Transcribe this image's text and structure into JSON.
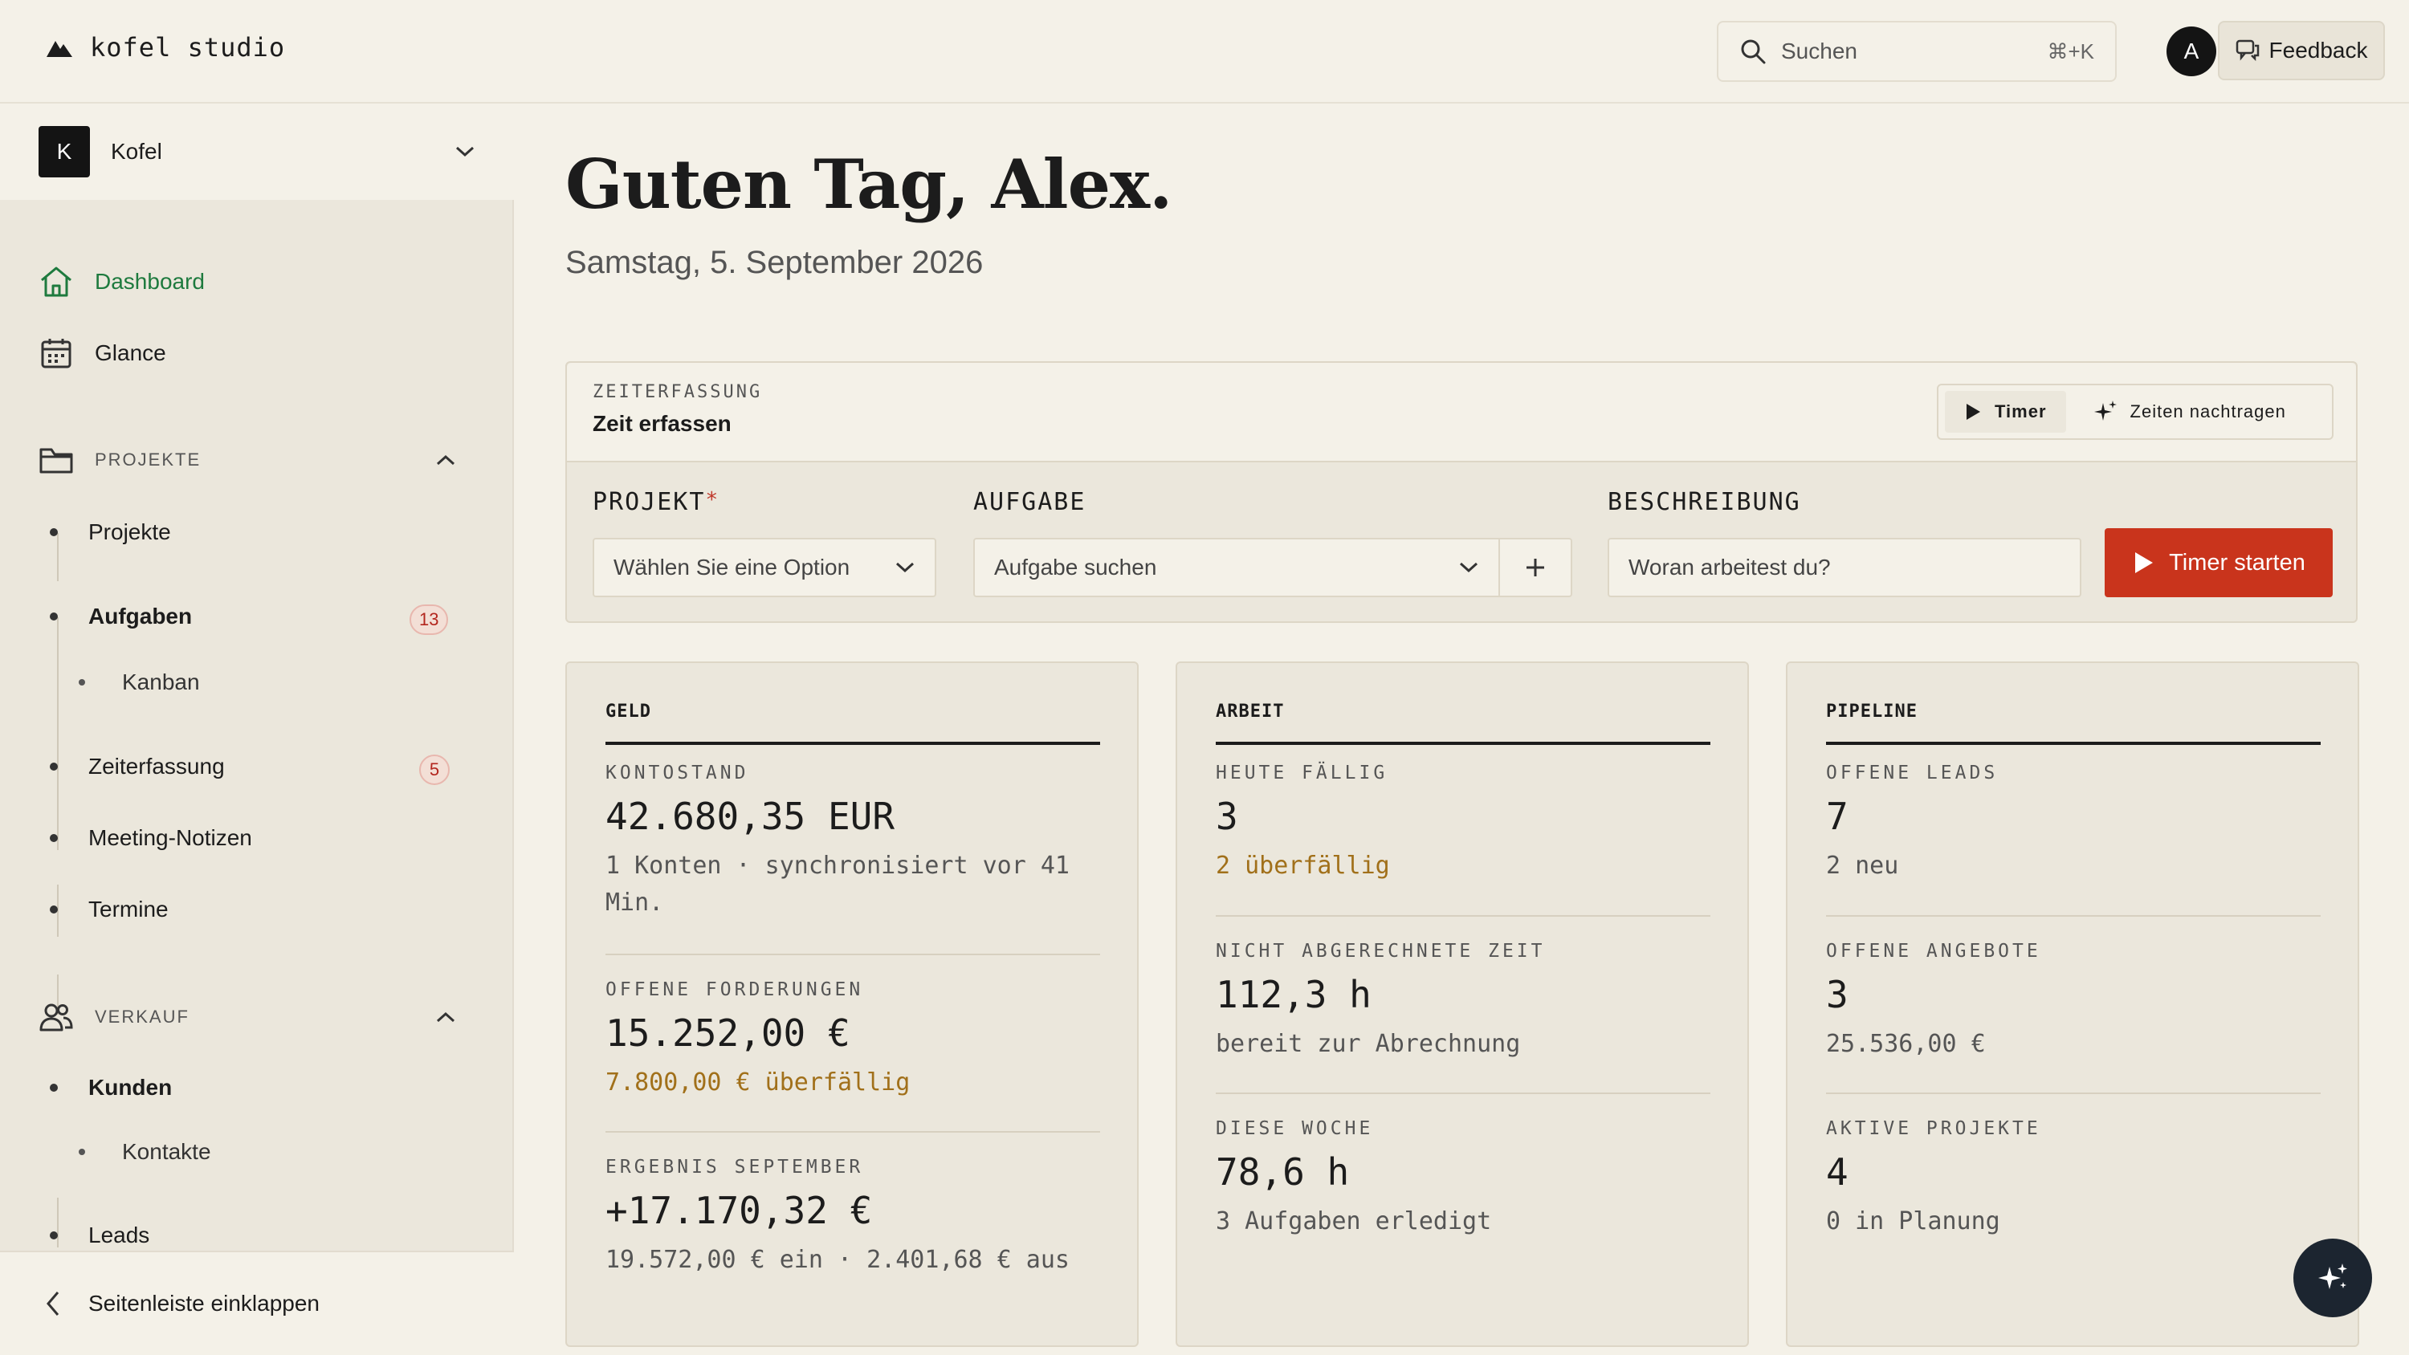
{
  "brand": {
    "name": "kofel studio"
  },
  "search": {
    "label": "Suchen",
    "shortcut": "⌘+K"
  },
  "user": {
    "initial": "A"
  },
  "feedback": {
    "label": "Feedback"
  },
  "workspace": {
    "initial": "K",
    "name": "Kofel"
  },
  "nav": {
    "dashboard": "Dashboard",
    "glance": "Glance",
    "projects_section": "PROJEKTE",
    "projects": "Projekte",
    "tasks": "Aufgaben",
    "tasks_badge": "13",
    "kanban": "Kanban",
    "time_tracking": "Zeiterfassung",
    "time_badge": "5",
    "meeting_notes": "Meeting-Notizen",
    "appointments": "Termine",
    "sales_section": "VERKAUF",
    "customers": "Kunden",
    "contacts": "Kontakte",
    "leads": "Leads",
    "collapse": "Seitenleiste einklappen"
  },
  "greeting": {
    "title": "Guten Tag, Alex.",
    "date": "Samstag, 5. September 2026"
  },
  "time_entry": {
    "kicker": "ZEITERFASSUNG",
    "title": "Zeit erfassen",
    "mode_timer": "Timer",
    "mode_backfill": "Zeiten nachtragen",
    "project_label": "PROJEKT",
    "required_mark": "*",
    "project_placeholder": "Wählen Sie eine Option",
    "task_label": "AUFGABE",
    "task_placeholder": "Aufgabe suchen",
    "description_label": "BESCHREIBUNG",
    "description_placeholder": "Woran arbeitest du?",
    "start_button": "Timer starten"
  },
  "cards": {
    "money": {
      "title": "GELD",
      "balance_label": "KONTOSTAND",
      "balance_value": "42.680,35 EUR",
      "balance_sub": "1 Konten · synchronisiert vor 41 Min.",
      "receivables_label": "OFFENE FORDERUNGEN",
      "receivables_value": "15.252,00 €",
      "receivables_sub": "7.800,00 € überfällig",
      "result_label": "ERGEBNIS SEPTEMBER",
      "result_value": "+17.170,32 €",
      "result_sub": "19.572,00 € ein · 2.401,68 € aus"
    },
    "work": {
      "title": "ARBEIT",
      "due_label": "HEUTE FÄLLIG",
      "due_value": "3",
      "due_sub": "2 überfällig",
      "unbilled_label": "NICHT ABGERECHNETE ZEIT",
      "unbilled_value": "112,3 h",
      "unbilled_sub": "bereit zur Abrechnung",
      "week_label": "DIESE WOCHE",
      "week_value": "78,6 h",
      "week_sub": "3 Aufgaben erledigt"
    },
    "pipeline": {
      "title": "PIPELINE",
      "leads_label": "OFFENE LEADS",
      "leads_value": "7",
      "leads_sub": "2 neu",
      "offers_label": "OFFENE ANGEBOTE",
      "offers_value": "3",
      "offers_sub": "25.536,00 €",
      "projects_label": "AKTIVE PROJEKTE",
      "projects_value": "4",
      "projects_sub": "0 in Planung"
    }
  }
}
